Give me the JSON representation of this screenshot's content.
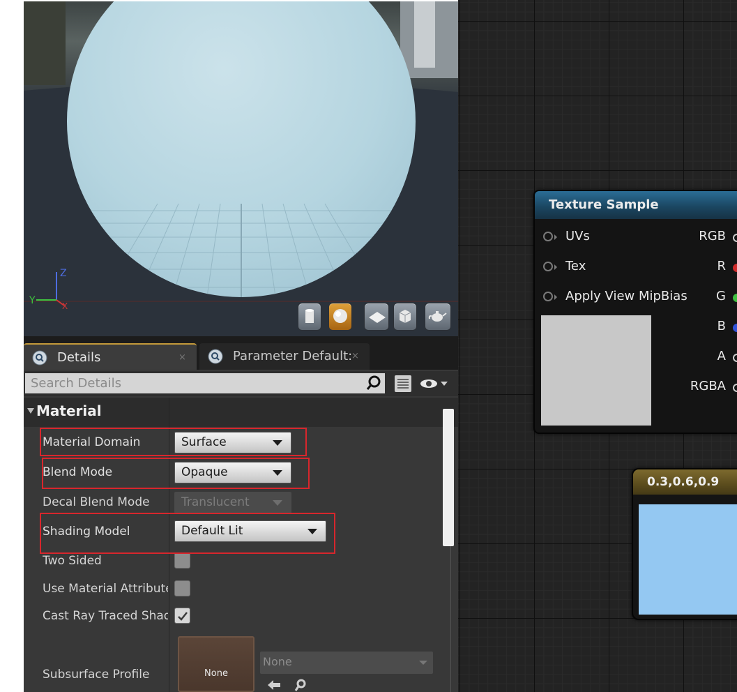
{
  "viewport": {
    "axis_z": "Z",
    "axis_y": "Y",
    "axis_x": "X",
    "view_buttons": [
      "cylinder-preview-icon",
      "sphere-preview-icon",
      "plane-preview-icon",
      "cube-preview-icon",
      "teapot-preview-icon"
    ],
    "active_button": "sphere-preview-icon"
  },
  "tabs": {
    "details": "Details",
    "parameter_defaults": "Parameter Default:",
    "close": "×"
  },
  "search": {
    "placeholder": "Search Details"
  },
  "category": {
    "label": "Material"
  },
  "properties": {
    "material_domain": {
      "label": "Material Domain",
      "value": "Surface"
    },
    "blend_mode": {
      "label": "Blend Mode",
      "value": "Opaque"
    },
    "decal_blend_mode": {
      "label": "Decal Blend Mode",
      "value": "Translucent"
    },
    "shading_model": {
      "label": "Shading Model",
      "value": "Default Lit"
    },
    "two_sided": {
      "label": "Two Sided",
      "checked": false
    },
    "use_material_attributes": {
      "label": "Use Material Attribute",
      "checked": false
    },
    "cast_ray_traced_shadows": {
      "label": "Cast Ray Traced Shad",
      "checked": true
    },
    "subsurface_profile": {
      "label": "Subsurface Profile",
      "thumb": "None",
      "asset": "None"
    }
  },
  "graph": {
    "texture_sample": {
      "title": "Texture Sample",
      "inputs": [
        "UVs",
        "Tex",
        "Apply View MipBias"
      ],
      "outputs": [
        "RGB",
        "R",
        "G",
        "B",
        "A",
        "RGBA"
      ]
    },
    "constant_node": {
      "title": "0.3,0.6,0.9"
    }
  },
  "colors": {
    "highlight": "#d8262c",
    "texture_header": "#1b4762",
    "constant_header": "#5b4c1d",
    "constant_color": "#94c8f2",
    "pin_r": "#d02a2a",
    "pin_g": "#3fbf3f",
    "pin_b": "#3152d9"
  }
}
